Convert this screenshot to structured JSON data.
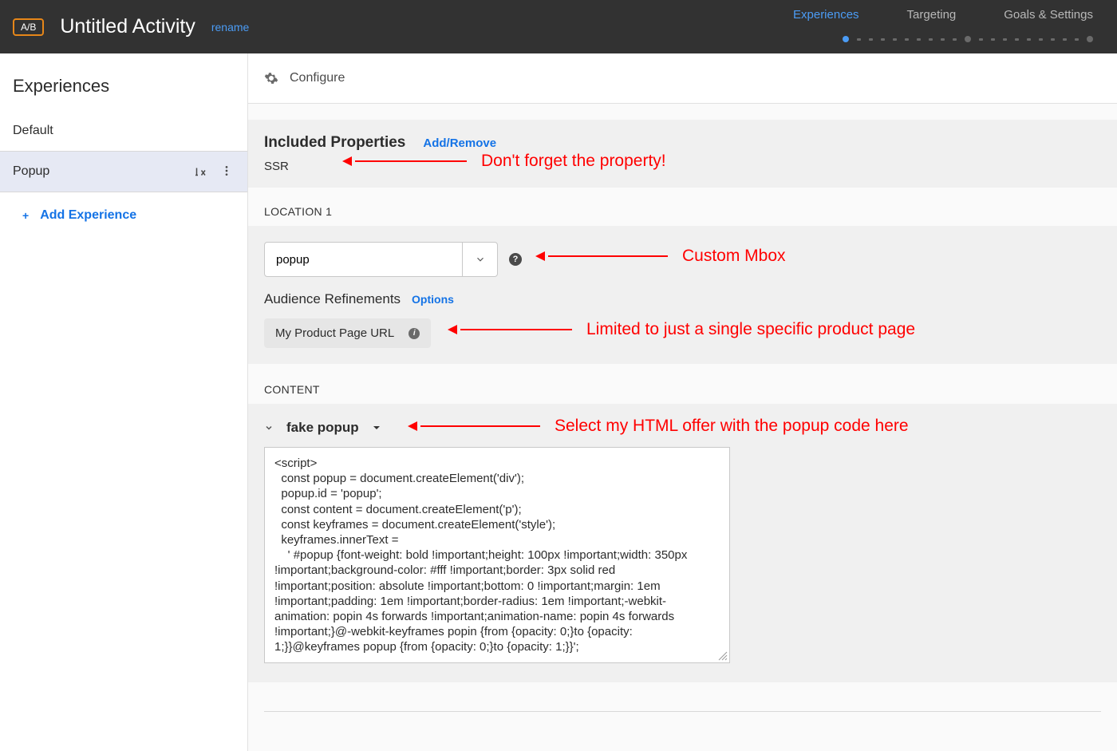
{
  "header": {
    "badge": "A/B",
    "title": "Untitled Activity",
    "rename": "rename",
    "steps": [
      "Experiences",
      "Targeting",
      "Goals & Settings"
    ],
    "active_step": 0
  },
  "sidebar": {
    "title": "Experiences",
    "items": [
      {
        "label": "Default",
        "selected": false
      },
      {
        "label": "Popup",
        "selected": true
      }
    ],
    "add_label": "Add Experience"
  },
  "configure": {
    "label": "Configure"
  },
  "properties": {
    "title": "Included Properties",
    "action": "Add/Remove",
    "value": "SSR"
  },
  "location": {
    "label": "LOCATION 1",
    "mbox_value": "popup",
    "audience_label": "Audience Refinements",
    "audience_action": "Options",
    "audience_chip": "My Product Page URL"
  },
  "content": {
    "label": "CONTENT",
    "offer_name": "fake popup",
    "code": "<script>\n  const popup = document.createElement('div');\n  popup.id = 'popup';\n  const content = document.createElement('p');\n  const keyframes = document.createElement('style');\n  keyframes.innerText =\n    ' #popup {font-weight: bold !important;height: 100px !important;width: 350px !important;background-color: #fff !important;border: 3px solid red !important;position: absolute !important;bottom: 0 !important;margin: 1em !important;padding: 1em !important;border-radius: 1em !important;-webkit-animation: popin 4s forwards !important;animation-name: popin 4s forwards !important;}@-webkit-keyframes popin {from {opacity: 0;}to {opacity: 1;}}@keyframes popup {from {opacity: 0;}to {opacity: 1;}}';"
  },
  "annotations": {
    "a1": "Don't forget the property!",
    "a2": "Custom Mbox",
    "a3": "Limited to just a single specific product page",
    "a4": "Select my HTML offer with the popup code here"
  }
}
